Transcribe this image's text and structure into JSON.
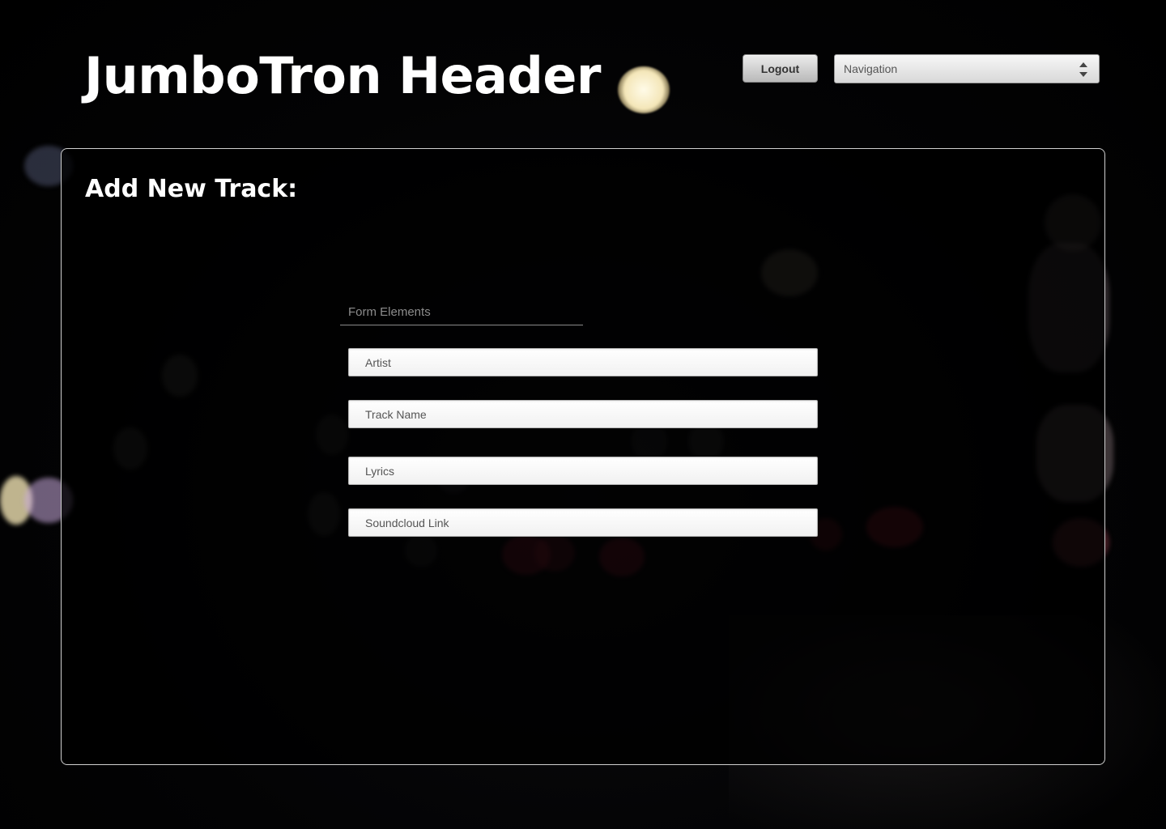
{
  "header": {
    "title": "JumboTron Header",
    "logout_label": "Logout",
    "navigation_label": "Navigation"
  },
  "form": {
    "heading": "Add New Track:",
    "legend": "Form Elements",
    "fields": {
      "artist": {
        "placeholder": "Artist"
      },
      "track_name": {
        "placeholder": "Track Name"
      },
      "lyrics": {
        "placeholder": "Lyrics"
      },
      "soundcloud_link": {
        "placeholder": "Soundcloud Link"
      }
    }
  },
  "icons": {
    "select_arrows": "updown-arrows-icon"
  },
  "colors": {
    "background": "#000000",
    "text": "#ffffff",
    "panel_border": "#d0d0d0"
  }
}
